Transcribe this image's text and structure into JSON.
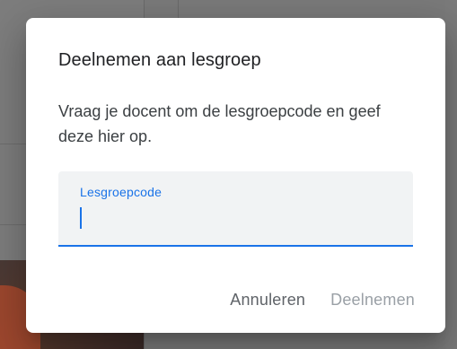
{
  "dialog": {
    "title": "Deelnemen aan lesgroep",
    "body": "Vraag je docent om de lesgroepcode en geef deze hier op.",
    "field": {
      "label": "Lesgroepcode",
      "value": "",
      "accent_color": "#1a73e8"
    },
    "actions": {
      "cancel_label": "Annuleren",
      "join_label": "Deelnemen",
      "join_disabled": true
    }
  }
}
